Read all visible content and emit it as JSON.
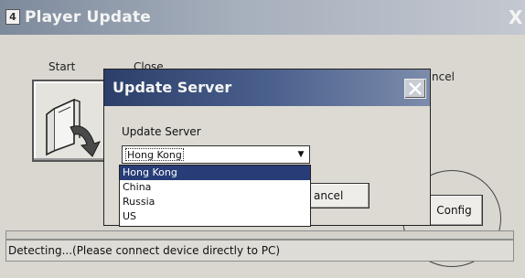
{
  "window": {
    "icon_glyph": "4",
    "title": "Player Update",
    "close_glyph": "X"
  },
  "labels": {
    "start": "Start",
    "close": "Close",
    "cancel_partial": "ncel"
  },
  "config_button": "Config",
  "status": "Detecting...(Please connect device directly to PC)",
  "dialog": {
    "title": "Update Server",
    "field_label": "Update Server",
    "selected": "Hong Kong",
    "cancel_partial": "ancel",
    "options": [
      "Hong Kong",
      "China",
      "Russia",
      "US"
    ]
  }
}
